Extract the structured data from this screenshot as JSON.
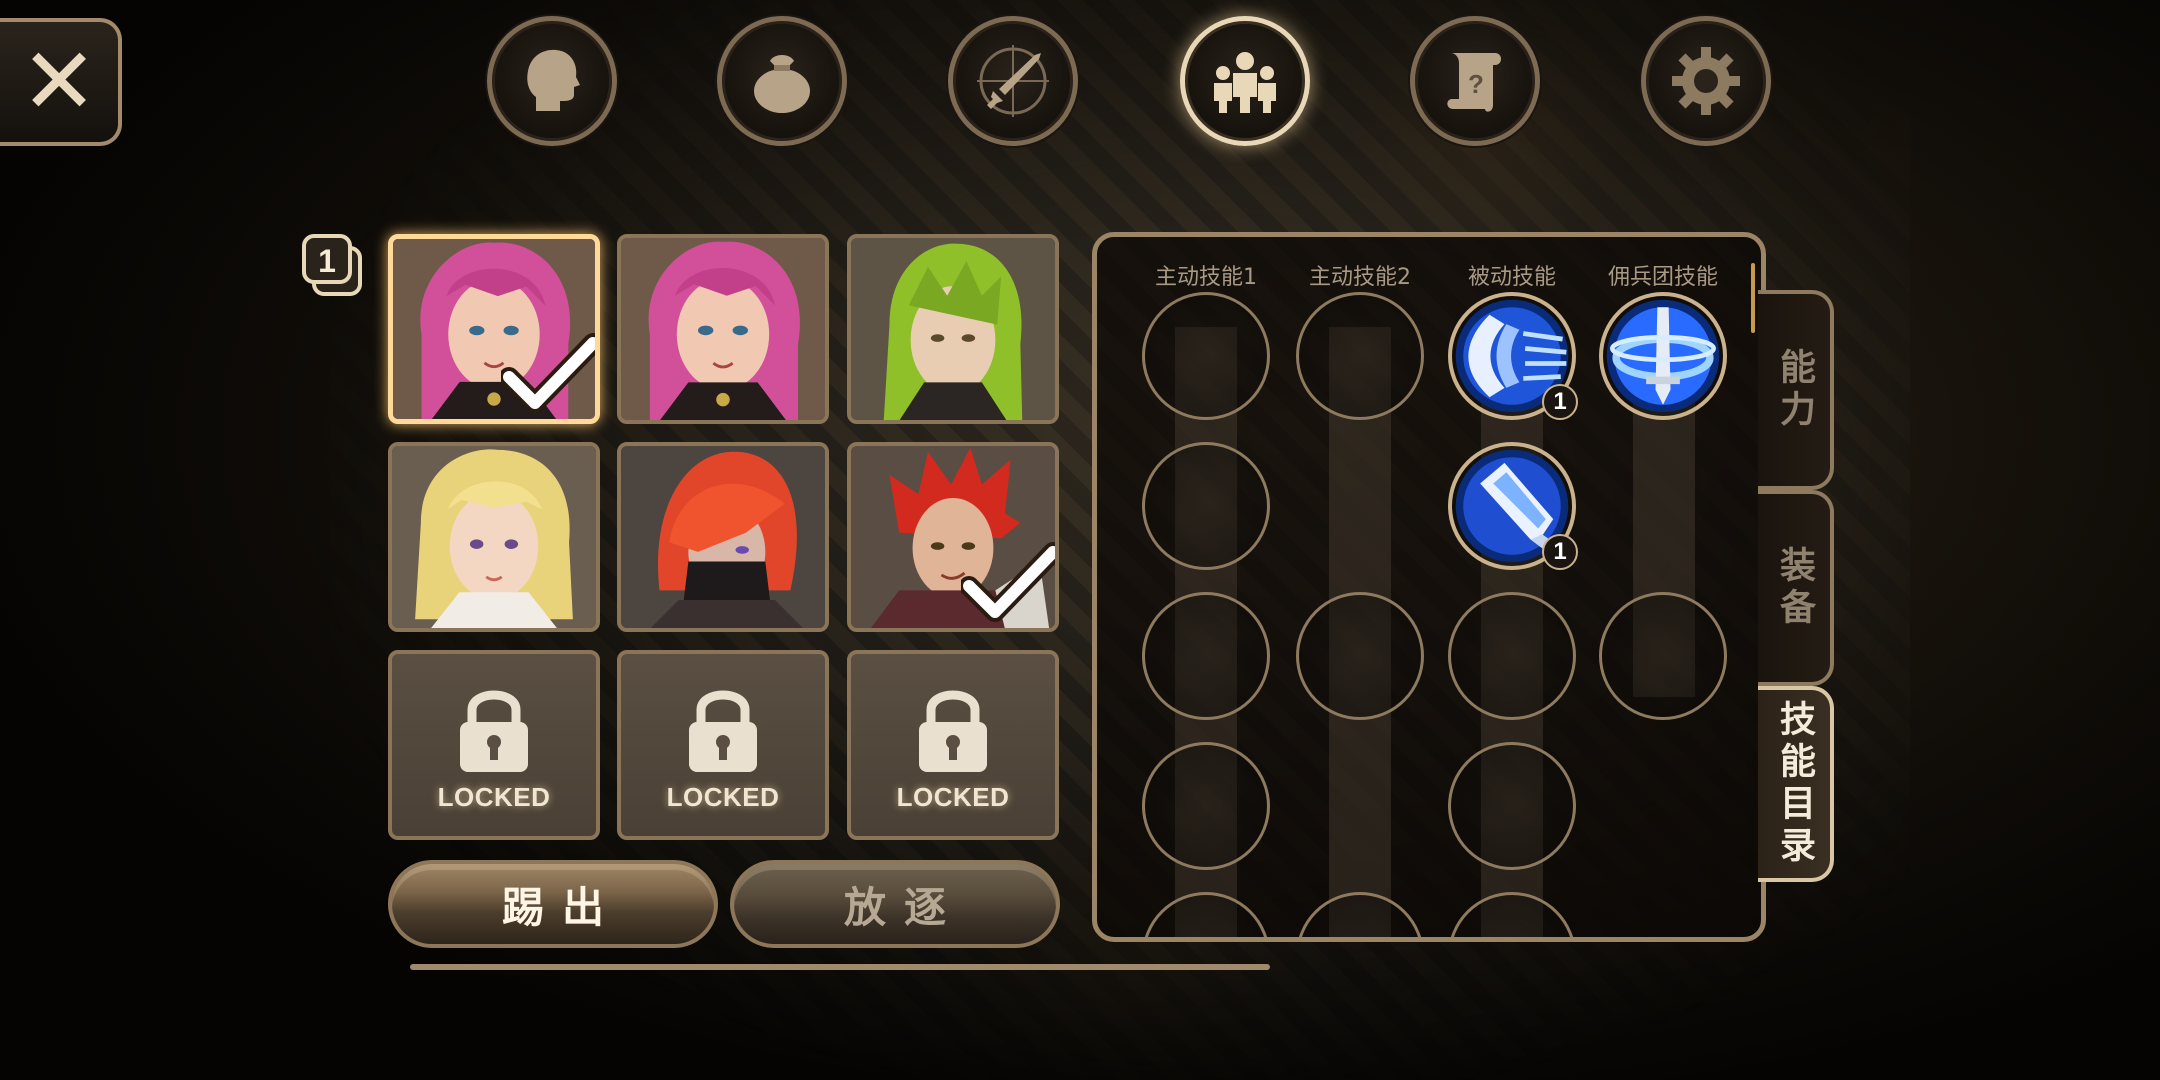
{
  "nav": {
    "close_label": "✕",
    "tabs": [
      {
        "name": "profile",
        "icon": "head-icon",
        "active": false
      },
      {
        "name": "inventory",
        "icon": "bag-icon",
        "active": false
      },
      {
        "name": "battle",
        "icon": "sword-compass-icon",
        "active": false
      },
      {
        "name": "mercenary",
        "icon": "group-icon",
        "active": true
      },
      {
        "name": "quest",
        "icon": "scroll-icon",
        "active": false
      },
      {
        "name": "settings",
        "icon": "gear-icon",
        "active": false
      }
    ]
  },
  "roster": {
    "count_badge": "1",
    "slots": [
      {
        "hair": "#d2509a",
        "skin": "#f1c9b3",
        "selected": true,
        "checked": true
      },
      {
        "hair": "#d2509a",
        "skin": "#f1c9b3",
        "selected": false,
        "checked": false
      },
      {
        "hair": "#8fc02a",
        "skin": "#e8cdb2",
        "selected": false,
        "checked": false
      },
      {
        "hair": "#e8d37a",
        "skin": "#f3d7c2",
        "selected": false,
        "checked": false
      },
      {
        "hair": "#e2462a",
        "skin": "#d8b6a8",
        "selected": false,
        "checked": false
      },
      {
        "hair": "#d22a1e",
        "skin": "#e0b497",
        "selected": false,
        "checked": true
      }
    ],
    "locked_label": "LOCKED",
    "kick_button": "踢出",
    "exile_button": "放逐"
  },
  "skills": {
    "columns": [
      "主动技能1",
      "主动技能2",
      "被动技能",
      "佣兵团技能"
    ],
    "passive_level_1": "1",
    "passive_level_2": "1",
    "icons": [
      "shield-dash-icon",
      "sword-whirl-icon",
      "sword-slash-icon"
    ]
  },
  "side_tabs": {
    "ability": "能力",
    "equipment": "装备",
    "skill_list": "技能目录"
  },
  "colors": {
    "frame": "#9c8466",
    "highlight": "#ffd99a",
    "skill_blue": "#2f7bff"
  }
}
